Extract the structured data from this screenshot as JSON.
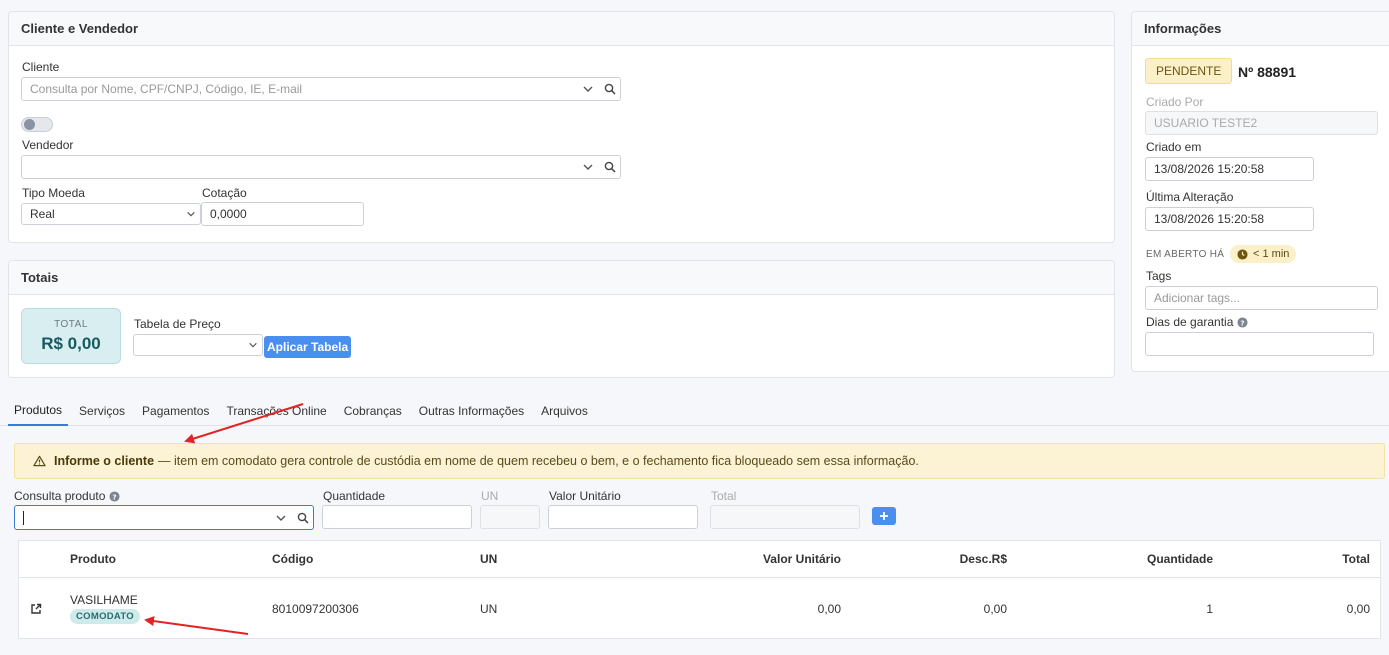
{
  "cliente_vendedor": {
    "title": "Cliente e Vendedor",
    "cliente_label": "Cliente",
    "cliente_placeholder": "Consulta por Nome, CPF/CNPJ, Código, IE, E-mail",
    "vendedor_label": "Vendedor",
    "vendedor_value": "",
    "tipo_moeda_label": "Tipo Moeda",
    "tipo_moeda_value": "Real",
    "cotacao_label": "Cotação",
    "cotacao_value": "0,0000"
  },
  "totais": {
    "title": "Totais",
    "total_label": "TOTAL",
    "total_value": "R$ 0,00",
    "tabela_preco_label": "Tabela de Preço",
    "tabela_preco_value": "",
    "aplicar_label": "Aplicar Tabela"
  },
  "informacoes": {
    "title": "Informações",
    "status": "PENDENTE",
    "numero": "Nº 88891",
    "criado_por_label": "Criado Por",
    "criado_por_value": "USUARIO TESTE2",
    "criado_em_label": "Criado em",
    "criado_em_value": "13/08/2026 15:20:58",
    "ultima_alteracao_label": "Última Alteração",
    "ultima_alteracao_value": "13/08/2026 15:20:58",
    "em_aberto_label": "EM ABERTO HÁ",
    "em_aberto_value": "< 1 min",
    "tags_label": "Tags",
    "tags_placeholder": "Adicionar tags...",
    "dias_garantia_label": "Dias de garantia",
    "dias_garantia_value": ""
  },
  "tabs": [
    {
      "label": "Produtos",
      "active": true
    },
    {
      "label": "Serviços"
    },
    {
      "label": "Pagamentos"
    },
    {
      "label": "Transações Online"
    },
    {
      "label": "Cobranças"
    },
    {
      "label": "Outras Informações"
    },
    {
      "label": "Arquivos"
    }
  ],
  "alert": {
    "icon": "warning-icon",
    "bold": "Informe o cliente",
    "text": "— item em comodato gera controle de custódia em nome de quem recebeu o bem, e o fechamento fica bloqueado sem essa informação."
  },
  "produto_form": {
    "consulta_label": "Consulta produto",
    "consulta_value": "",
    "quantidade_label": "Quantidade",
    "quantidade_value": "",
    "un_label": "UN",
    "valor_unitario_label": "Valor Unitário",
    "valor_unitario_value": "",
    "total_label": "Total",
    "add_icon": "plus-icon"
  },
  "table": {
    "headers": {
      "produto": "Produto",
      "codigo": "Código",
      "un": "UN",
      "valor_unitario": "Valor Unitário",
      "desc": "Desc.R$",
      "quantidade": "Quantidade",
      "total": "Total"
    },
    "rows": [
      {
        "produto": "VASILHAME",
        "tag": "COMODATO",
        "codigo": "8010097200306",
        "un": "UN",
        "valor_unitario": "0,00",
        "desc": "0,00",
        "quantidade": "1",
        "total": "0,00"
      }
    ]
  },
  "colors": {
    "accent": "#4a8ef0",
    "annotation_arrow": "#e02424",
    "alert_bg": "#fcf3d4",
    "status_bg": "#fcf0c8"
  }
}
